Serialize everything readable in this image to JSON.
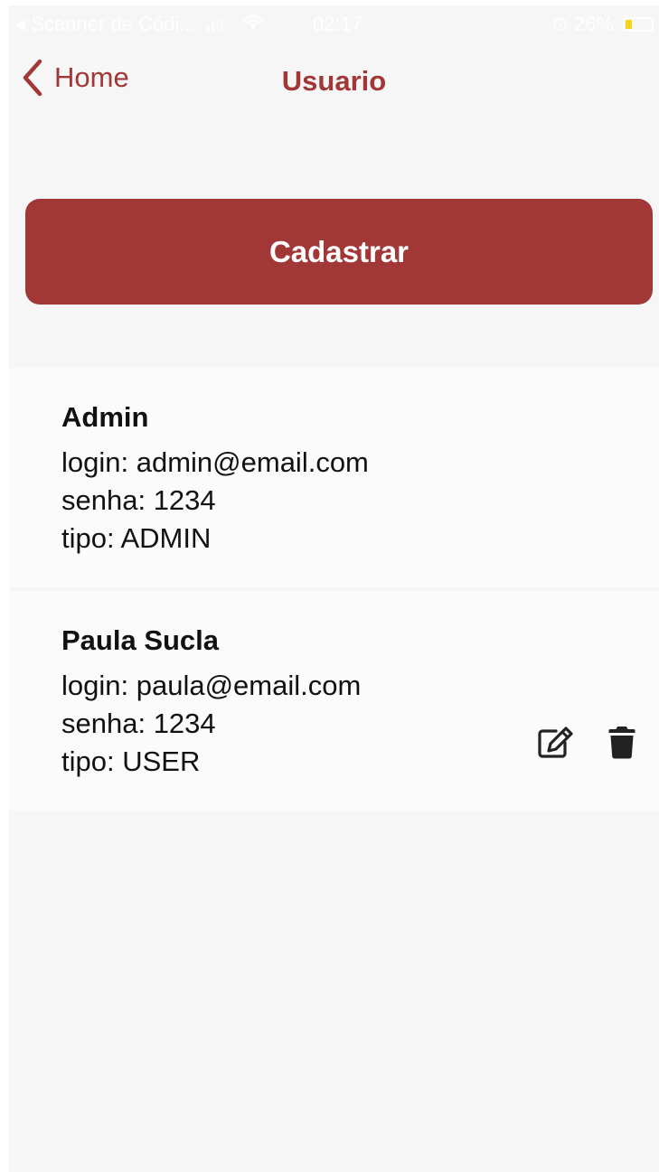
{
  "status_bar": {
    "back_app": "Scanner de Códi...",
    "time": "02:17",
    "battery_percent": "26%"
  },
  "nav": {
    "back_label": "Home",
    "title": "Usuario"
  },
  "actions": {
    "register_label": "Cadastrar"
  },
  "users": [
    {
      "name": "Admin",
      "login": "login: admin@email.com",
      "senha": "senha: 1234",
      "tipo": "tipo: ADMIN",
      "show_actions": false
    },
    {
      "name": "Paula Sucla",
      "login": "login: paula@email.com",
      "senha": "senha: 1234",
      "tipo": "tipo: USER",
      "show_actions": true
    }
  ],
  "icons": {
    "back": "chevron-left-icon",
    "edit": "edit-icon",
    "delete": "trash-icon"
  },
  "colors": {
    "accent": "#a23737",
    "background": "#f6f6f6",
    "card": "#fbfbfb",
    "text": "#111111",
    "battery": "#f4d000"
  }
}
